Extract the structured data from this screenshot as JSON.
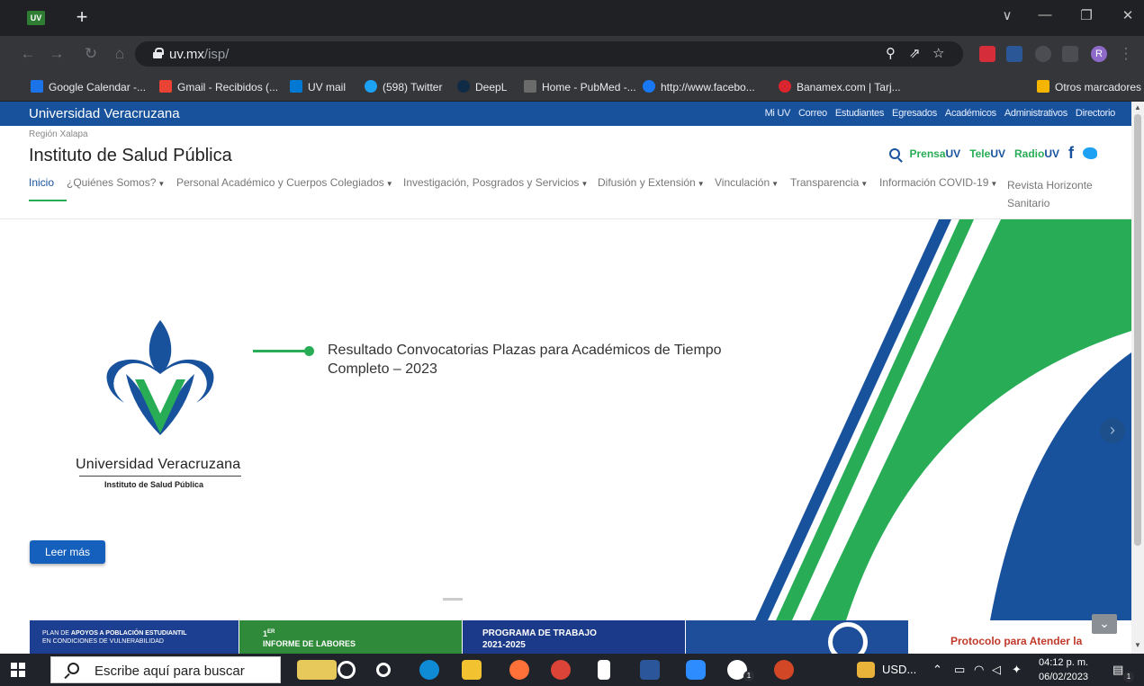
{
  "browser": {
    "tab_favicon": "UV",
    "new_tab": "+",
    "url_host": "uv.mx",
    "url_path": "/isp/",
    "window_controls": [
      "∨",
      "—",
      "❐",
      "✕"
    ],
    "profile": "R",
    "bookmarks": [
      {
        "label": "Google Calendar -...",
        "icon": "calendar-icon",
        "color": "#1a73e8"
      },
      {
        "label": "Gmail - Recibidos (...",
        "icon": "gmail-icon",
        "color": "#ea4335"
      },
      {
        "label": "UV mail",
        "icon": "outlook-icon",
        "color": "#0078d4"
      },
      {
        "label": "(598) Twitter",
        "icon": "twitter-icon",
        "color": "#1da1f2"
      },
      {
        "label": "DeepL",
        "icon": "deepl-icon",
        "color": "#0f2b46"
      },
      {
        "label": "Home - PubMed -...",
        "icon": "pubmed-icon",
        "color": "#6b6b6b"
      },
      {
        "label": "http://www.facebo...",
        "icon": "facebook-icon",
        "color": "#1877f2"
      },
      {
        "label": "Banamex.com | Tarj...",
        "icon": "banamex-icon",
        "color": "#d9262e"
      }
    ],
    "other_bookmarks": "Otros marcadores"
  },
  "site": {
    "university": "Universidad Veracruzana",
    "top_links": [
      "Mi UV",
      "Correo",
      "Estudiantes",
      "Egresados",
      "Académicos",
      "Administrativos",
      "Directorio"
    ],
    "region": "Región Xalapa",
    "title": "Instituto de Salud Pública",
    "social": {
      "prensa_a": "Prensa",
      "prensa_b": "UV",
      "tele_a": "Tele",
      "tele_b": "UV",
      "radio_a": "Radio",
      "radio_b": "UV",
      "fb": "f"
    },
    "nav": [
      {
        "label": "Inicio",
        "caret": ""
      },
      {
        "label": "¿Quiénes Somos?",
        "caret": "▼"
      },
      {
        "label": "Personal Académico y Cuerpos Colegiados",
        "caret": "▼"
      },
      {
        "label": "Investigación, Posgrados y Servicios",
        "caret": "▼"
      },
      {
        "label": "Difusión y Extensión",
        "caret": "▼"
      },
      {
        "label": "Vinculación",
        "caret": "▼"
      },
      {
        "label": "Transparencia",
        "caret": "▼"
      },
      {
        "label": "Información COVID-19",
        "caret": "▼"
      },
      {
        "label": "Revista Horizonte",
        "caret": ""
      }
    ],
    "nav_last_line2": "Sanitario"
  },
  "hero": {
    "headline": "Resultado Convocatorias Plazas para Académicos de Tiempo Completo – 2023",
    "logo_name": "Universidad Veracruzana",
    "logo_sub": "Instituto de Salud Pública",
    "button": "Leer más",
    "next": "›"
  },
  "banners": {
    "b1_line1_a": "PLAN DE ",
    "b1_line1_b": "APOYOS A POBLACIÓN ESTUDIANTIL",
    "b1_line2": "EN CONDICIONES DE VULNERABILIDAD",
    "b2_sup": "ER",
    "b2_num": "1",
    "b2_text": "INFORME DE LABORES",
    "b3_line1": "PROGRAMA DE TRABAJO",
    "b3_line2": "2021-2025",
    "b5_text": "Protocolo para Atender la",
    "collapse": "⌄"
  },
  "taskbar": {
    "search_placeholder": "Escribe aquí para buscar",
    "weather": "USD...",
    "time": "04:12 p. m.",
    "date": "06/02/2023",
    "badge": "1"
  },
  "colors": {
    "uv_blue": "#18529d",
    "uv_green": "#28ad56"
  }
}
